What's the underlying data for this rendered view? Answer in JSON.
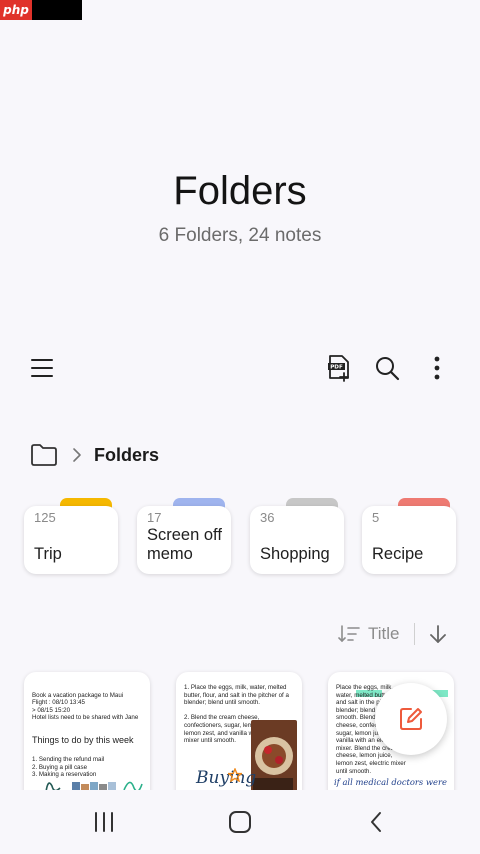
{
  "watermark": {
    "text": "php"
  },
  "header": {
    "title": "Folders",
    "subtitle": "6 Folders, 24 notes"
  },
  "toolbar": {
    "menu_icon": "hamburger-menu-icon",
    "pdf_icon": "pdf-add-icon",
    "search_icon": "search-icon",
    "more_icon": "more-vertical-icon"
  },
  "breadcrumb": {
    "icon": "folder-icon",
    "label": "Folders"
  },
  "folders": [
    {
      "count": "125",
      "name": "Trip",
      "color": "#f5b800"
    },
    {
      "count": "17",
      "name": "Screen off memo",
      "color": "#9fb4ee"
    },
    {
      "count": "36",
      "name": "Shopping",
      "color": "#c7c7c7"
    },
    {
      "count": "5",
      "name": "Recipe",
      "color": "#ee7a72"
    }
  ],
  "sort": {
    "label": "Title",
    "icon": "sort-icon",
    "direction_icon": "arrow-down-icon"
  },
  "notes": [
    {
      "text": "Book a vacation package to Maui\nFlight : 08/10 13:45\n  > 08/15 15:20\nHotel lists need to be shared with Jane",
      "heading": "Things to do by this week",
      "list": "1. Sending the refund mail\n2. Buying a pill case\n3. Making a reservation"
    },
    {
      "text": "1. Place the eggs, milk, water, melted butter, flour, and salt in the pitcher of a blender; blend until smooth.\n\n2. Blend the cream cheese, confectioners, sugar, lemon juice, lemon zest, and vanilla with an electric mixer until smooth.",
      "handwriting": "Buying"
    },
    {
      "text": "Place the eggs, milk, water, melted butter, flour, and salt in the pitcher of a blender; blend until smooth. Blend the cream cheese, confectioners, sugar, lemon juice, and vanilla with an electric mixer. Blend the cream cheese, lemon juice, lemon zest, electric mixer until smooth.",
      "handwriting": "if all medical doctors were\nto forsake general practice"
    }
  ],
  "fab": {
    "icon": "compose-note-icon",
    "color": "#ee5a3c"
  },
  "navbar": {
    "recents_icon": "recent-apps-icon",
    "home_icon": "home-icon",
    "back_icon": "back-icon"
  }
}
